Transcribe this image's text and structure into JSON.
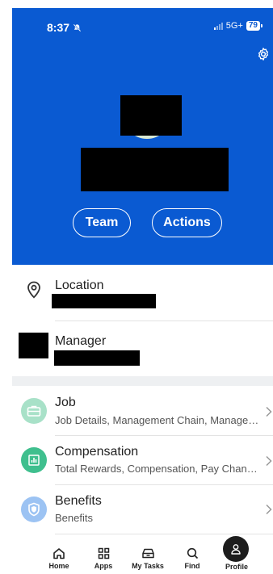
{
  "status_bar": {
    "time": "8:37",
    "network": "5G+",
    "battery": "79"
  },
  "header": {
    "team_label": "Team",
    "actions_label": "Actions"
  },
  "info": {
    "location_label": "Location",
    "manager_label": "Manager"
  },
  "menu": [
    {
      "title": "Job",
      "subtitle": "Job Details, Management Chain, Manage…",
      "icon": "briefcase-icon"
    },
    {
      "title": "Compensation",
      "subtitle": "Total Rewards, Compensation, Pay Chan…",
      "icon": "chart-icon"
    },
    {
      "title": "Benefits",
      "subtitle": "Benefits",
      "icon": "shield-icon"
    }
  ],
  "tabs": [
    {
      "label": "Home",
      "icon": "home-icon"
    },
    {
      "label": "Apps",
      "icon": "grid-icon"
    },
    {
      "label": "My Tasks",
      "icon": "inbox-icon"
    },
    {
      "label": "Find",
      "icon": "search-icon"
    },
    {
      "label": "Profile",
      "icon": "person-icon",
      "active": true
    }
  ],
  "colors": {
    "brand_blue": "#0A5AD2",
    "job_icon": "#a8e1c8",
    "comp_icon": "#3fbf8e",
    "benefits_icon": "#9cc3f3"
  }
}
